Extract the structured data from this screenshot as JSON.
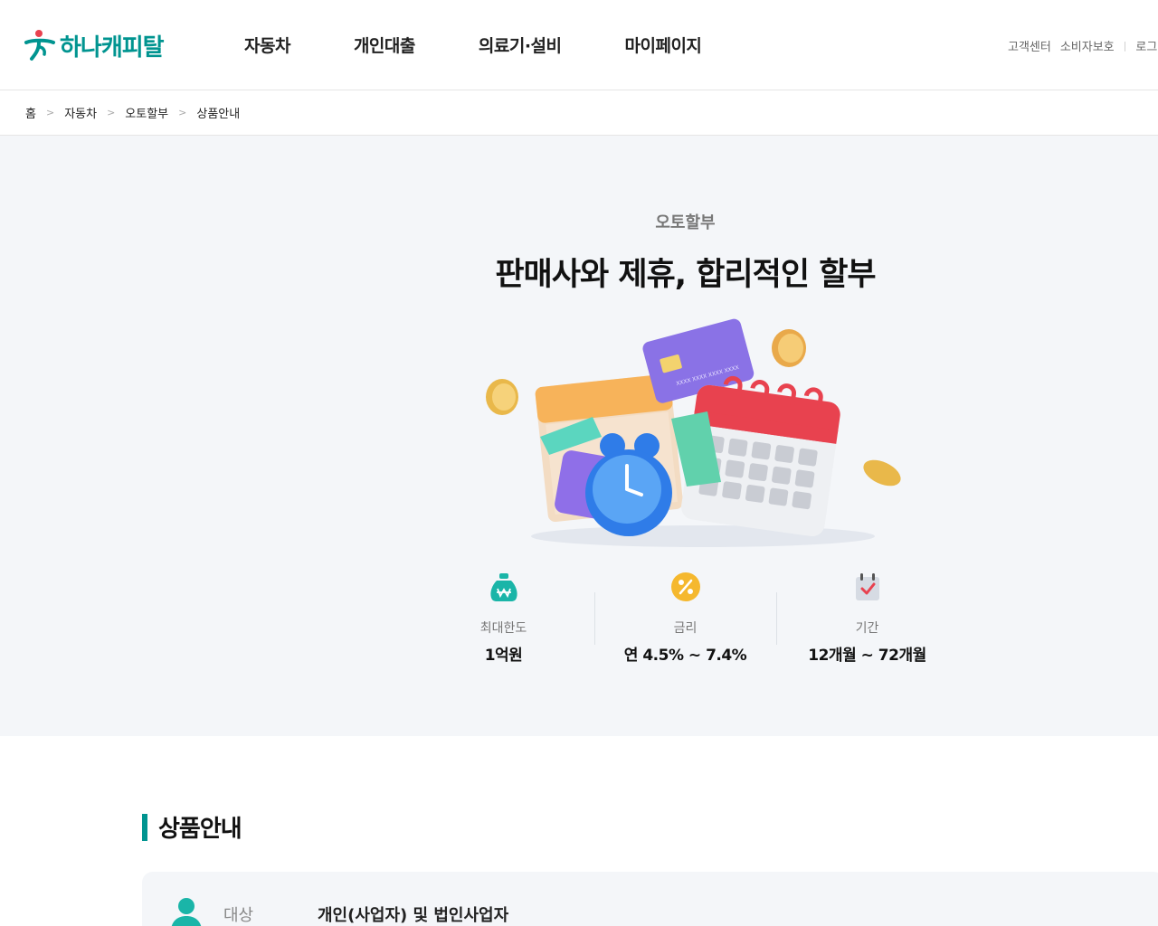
{
  "header": {
    "logo_text": "하나캐피탈",
    "nav": [
      "자동차",
      "개인대출",
      "의료기·설비",
      "마이페이지"
    ],
    "util": [
      "고객센터",
      "소비자보호",
      "로그"
    ]
  },
  "breadcrumb": [
    "홈",
    "자동차",
    "오토할부",
    "상품안내"
  ],
  "hero": {
    "eyebrow": "오토할부",
    "title": "판매사와 제휴, 합리적인 할부",
    "illustration_text": "XXXX XXXX XXXX XXXX",
    "stats": [
      {
        "icon": "money-bag-icon",
        "label": "최대한도",
        "value": "1억원",
        "color": "#1ab5a8"
      },
      {
        "icon": "percent-icon",
        "label": "금리",
        "value": "연 4.5% ~ 7.4%",
        "color": "#f5b82e"
      },
      {
        "icon": "calendar-check-icon",
        "label": "기간",
        "value": "12개월 ~ 72개월",
        "color": "#e8424f"
      }
    ]
  },
  "section": {
    "title": "상품안내",
    "rows": [
      {
        "icon": "person-icon",
        "label": "대상",
        "value": "개인(사업자) 및 법인사업자"
      }
    ]
  },
  "colors": {
    "brand": "#009490",
    "accent_red": "#e8424f",
    "hero_bg": "#f4f6f9"
  }
}
